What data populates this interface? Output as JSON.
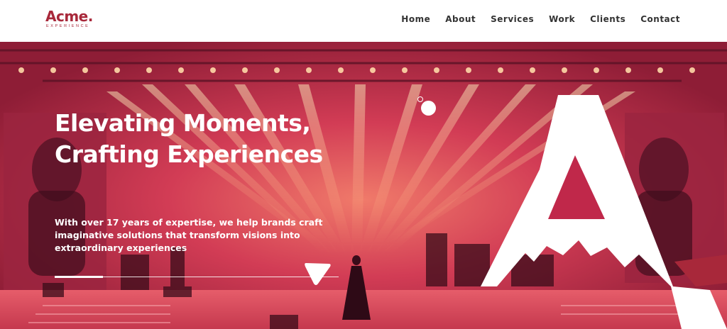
{
  "brand": {
    "name": "Acme.",
    "tagline": "EXPERIENCE",
    "color": "#a8283a"
  },
  "nav": {
    "items": [
      {
        "label": "Home"
      },
      {
        "label": "About"
      },
      {
        "label": "Services"
      },
      {
        "label": "Work"
      },
      {
        "label": "Clients"
      },
      {
        "label": "Contact"
      }
    ]
  },
  "hero": {
    "headline_line1": "Elevating Moments,",
    "headline_line2": "Crafting Experiences",
    "subtext": "With over 17 years of expertise, we help brands craft imaginative solutions that transform visions into extraordinary experiences",
    "overlay_color": "#c0284a",
    "slider_progress": 0.17
  },
  "icons": {
    "hero_image": "concert-stage-image",
    "decor_letter": "brand-letter-a-icon",
    "triangle": "triangle-icon",
    "circle": "circle-icon"
  }
}
